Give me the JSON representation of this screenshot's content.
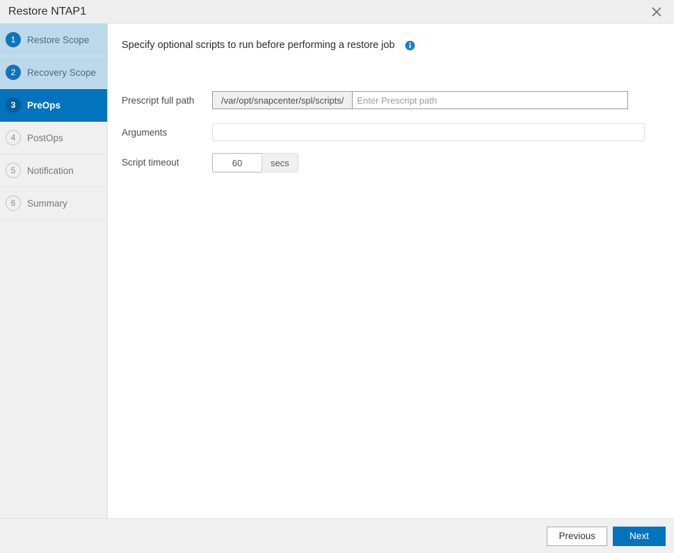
{
  "window": {
    "title": "Restore NTAP1",
    "close_icon": "close-icon"
  },
  "sidebar": {
    "steps": [
      {
        "number": "1",
        "label": "Restore Scope",
        "state": "done"
      },
      {
        "number": "2",
        "label": "Recovery Scope",
        "state": "done"
      },
      {
        "number": "3",
        "label": "PreOps",
        "state": "active"
      },
      {
        "number": "4",
        "label": "PostOps",
        "state": "pending"
      },
      {
        "number": "5",
        "label": "Notification",
        "state": "pending"
      },
      {
        "number": "6",
        "label": "Summary",
        "state": "pending"
      }
    ]
  },
  "main": {
    "heading": "Specify optional scripts to run before performing a restore job",
    "info_icon": "info-icon",
    "fields": {
      "prescript": {
        "label": "Prescript full path",
        "prefix": "/var/opt/snapcenter/spl/scripts/",
        "value": "",
        "placeholder": "Enter Prescript path"
      },
      "arguments": {
        "label": "Arguments",
        "value": "",
        "placeholder": ""
      },
      "script_timeout": {
        "label": "Script timeout",
        "value": "60",
        "unit": "secs"
      }
    }
  },
  "footer": {
    "previous_label": "Previous",
    "next_label": "Next"
  },
  "colors": {
    "accent": "#0273bd",
    "step_done_bg": "#bcd9ec",
    "step_pending_bg": "#f0f0f0",
    "info_icon": "#1c7ec4"
  }
}
